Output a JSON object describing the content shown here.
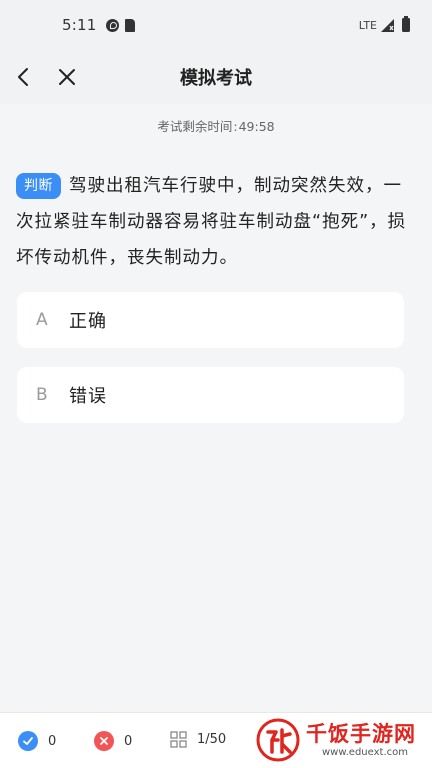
{
  "status_bar": {
    "time": "5:11",
    "network": "LTE"
  },
  "header": {
    "title": "模拟考试"
  },
  "timer": {
    "label": "考试剩余时间",
    "separator": ":",
    "value": "49:58"
  },
  "question": {
    "type_tag": "判断",
    "text": "驾驶出租汽车行驶中，制动突然失效，一次拉紧驻车制动器容易将驻车制动盘“抱死”，损坏传动机件，丧失制动力。"
  },
  "options": [
    {
      "letter": "A",
      "text": "正确"
    },
    {
      "letter": "B",
      "text": "错误"
    }
  ],
  "bottom_bar": {
    "correct_count": "0",
    "wrong_count": "0",
    "progress": "1/50"
  },
  "watermark": {
    "title": "千饭手游网",
    "url": "www.eduext.com"
  },
  "colors": {
    "accent": "#3a8ef6",
    "wrong": "#f25555",
    "watermark": "#e0251f",
    "background": "#f4f5f7"
  }
}
